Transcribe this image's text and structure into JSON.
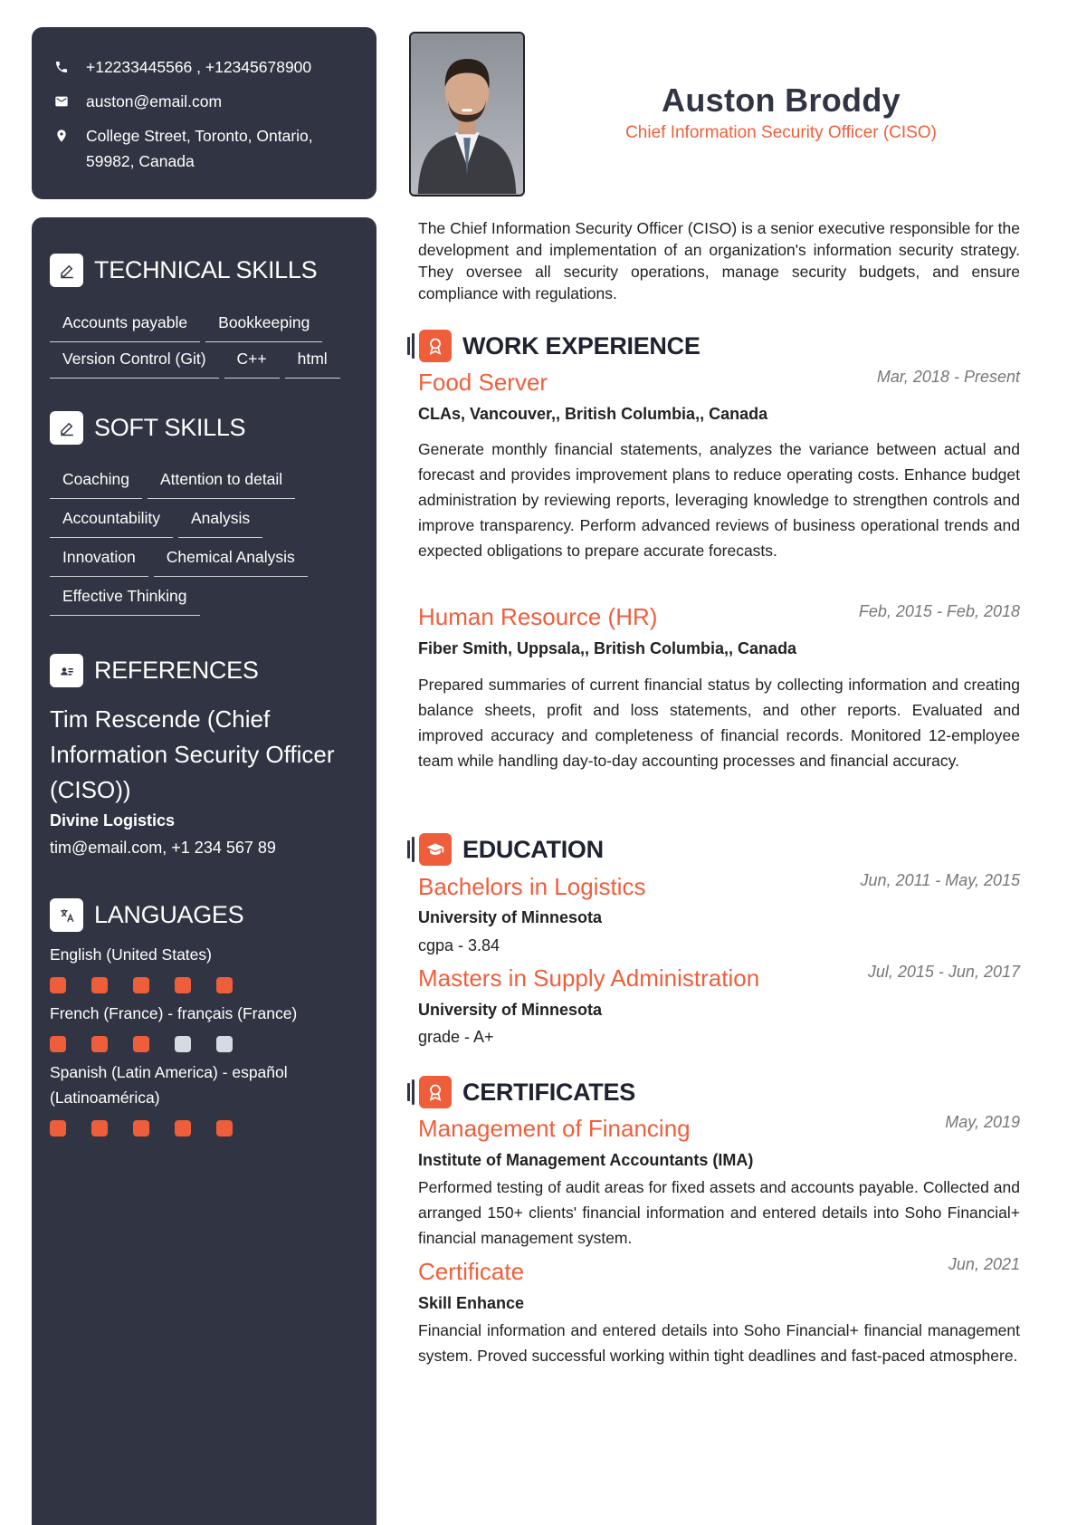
{
  "contact": {
    "phone": "+12233445566 , +12345678900",
    "email": "auston@email.com",
    "address": "College Street, Toronto, Ontario, 59982, Canada"
  },
  "technical_skills": {
    "heading": "TECHNICAL SKILLS",
    "items": [
      "Accounts payable",
      "Bookkeeping",
      "Version Control (Git)",
      "C++",
      "html"
    ]
  },
  "soft_skills": {
    "heading": "SOFT SKILLS",
    "items": [
      "Coaching",
      "Attention to detail",
      "Accountability",
      "Analysis",
      "Innovation",
      "Chemical Analysis",
      "Effective Thinking"
    ]
  },
  "references": {
    "heading": "REFERENCES",
    "name": "Tim Rescende (Chief Information Security Officer (CISO))",
    "company": "Divine Logistics",
    "contact": "tim@email.com, +1 234 567 89"
  },
  "languages": {
    "heading": "LANGUAGES",
    "items": [
      {
        "name": "English (United States)",
        "level": 5,
        "max": 5
      },
      {
        "name": "French (France) - français (France)",
        "level": 3,
        "max": 5
      },
      {
        "name": "Spanish (Latin America) - español (Latinoamérica)",
        "level": 5,
        "max": 5
      }
    ]
  },
  "header": {
    "name": "Auston Broddy",
    "title": "Chief Information Security Officer (CISO)"
  },
  "summary": "The Chief Information Security Officer (CISO) is a senior executive responsible for the development and implementation of an organization's information security strategy. They oversee all security operations, manage security budgets, and ensure compliance with regulations.",
  "work_experience": {
    "heading": "WORK EXPERIENCE",
    "items": [
      {
        "title": "Food Server",
        "date": "Mar, 2018 - Present",
        "company": "CLAs, Vancouver,, British Columbia,, Canada",
        "description": "Generate monthly financial statements, analyzes the variance between actual and forecast and provides improvement plans to reduce operating costs. Enhance budget administration by reviewing reports, leveraging knowledge to strengthen controls and improve transparency. Perform advanced reviews of business operational trends and expected obligations to prepare accurate forecasts."
      },
      {
        "title": "Human Resource (HR)",
        "date": "Feb, 2015 - Feb, 2018",
        "company": "Fiber Smith, Uppsala,, British Columbia,, Canada",
        "description": "Prepared summaries of current financial status by collecting information and creating balance sheets, profit and loss statements, and other reports. Evaluated and improved accuracy and completeness of financial records. Monitored 12-employee team while handling day-to-day accounting processes and financial accuracy."
      }
    ]
  },
  "education": {
    "heading": "EDUCATION",
    "items": [
      {
        "title": "Bachelors in Logistics",
        "date": "Jun, 2011 - May, 2015",
        "school": "University of Minnesota",
        "grade": "cgpa - 3.84"
      },
      {
        "title": "Masters in Supply Administration",
        "date": "Jul, 2015 - Jun, 2017",
        "school": "University of Minnesota",
        "grade": "grade - A+"
      }
    ]
  },
  "certificates": {
    "heading": "CERTIFICATES",
    "items": [
      {
        "title": "Management of Financing",
        "date": "May, 2019",
        "issuer": "Institute of Management Accountants (IMA)",
        "description": "Performed testing of audit areas for fixed assets and accounts payable. Collected and arranged 150+ clients' financial information and entered details into Soho Financial+ financial management system."
      },
      {
        "title": "Certificate",
        "date": "Jun, 2021",
        "issuer": "Skill Enhance",
        "description": "Financial information and entered details into Soho Financial+ financial management system. Proved successful working within tight deadlines and fast-paced atmosphere."
      }
    ]
  },
  "colors": {
    "sidebar": "#313443",
    "accent": "#ef5e3b",
    "dot_inactive": "#d5dae3"
  },
  "icons": {
    "phone": "phone-icon",
    "email": "mail-icon",
    "address": "location-pin-icon",
    "skills": "pencil-icon",
    "references": "contact-card-icon",
    "languages": "translate-icon",
    "work": "award-icon",
    "education": "graduation-cap-icon",
    "certificates": "award-icon"
  }
}
